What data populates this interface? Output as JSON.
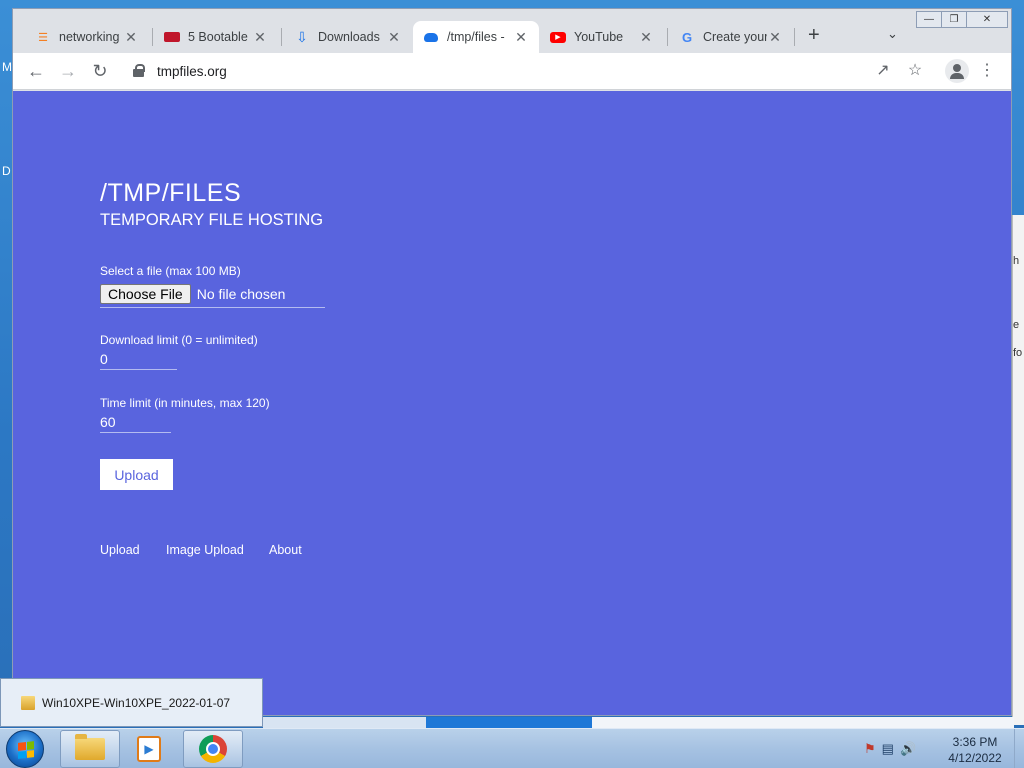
{
  "desktop": {
    "left_edge_chars": [
      "M",
      "D"
    ],
    "right_window_snippets": [
      "h",
      "e",
      "fo"
    ]
  },
  "browser": {
    "tabs": [
      {
        "title": "networking",
        "icon": "stack-overflow-icon",
        "active": false
      },
      {
        "title": "5 Bootable",
        "icon": "site-logo-icon",
        "active": false
      },
      {
        "title": "Downloads",
        "icon": "download-icon",
        "active": false
      },
      {
        "title": "/tmp/files -",
        "icon": "cloud-upload-icon",
        "active": true
      },
      {
        "title": "YouTube",
        "icon": "youtube-icon",
        "active": false
      },
      {
        "title": "Create your",
        "icon": "google-icon",
        "active": false
      }
    ],
    "new_tab_symbol": "+",
    "url": "tmpfiles.org"
  },
  "page": {
    "title": "/TMP/FILES",
    "subtitle": "TEMPORARY FILE HOSTING",
    "file_label": "Select a file (max 100 MB)",
    "choose_file_label": "Choose File",
    "no_file_text": "No file chosen",
    "download_limit_label": "Download limit (0 = unlimited)",
    "download_limit_value": "0",
    "time_limit_label": "Time limit (in minutes, max 120)",
    "time_limit_value": "60",
    "upload_button": "Upload",
    "footer_links": [
      "Upload",
      "Image Upload",
      "About"
    ],
    "background_color": "#5964de"
  },
  "taskbar": {
    "popup_title": "Win10XPE-Win10XPE_2022-01-07",
    "time": "3:36 PM",
    "date": "4/12/2022"
  }
}
